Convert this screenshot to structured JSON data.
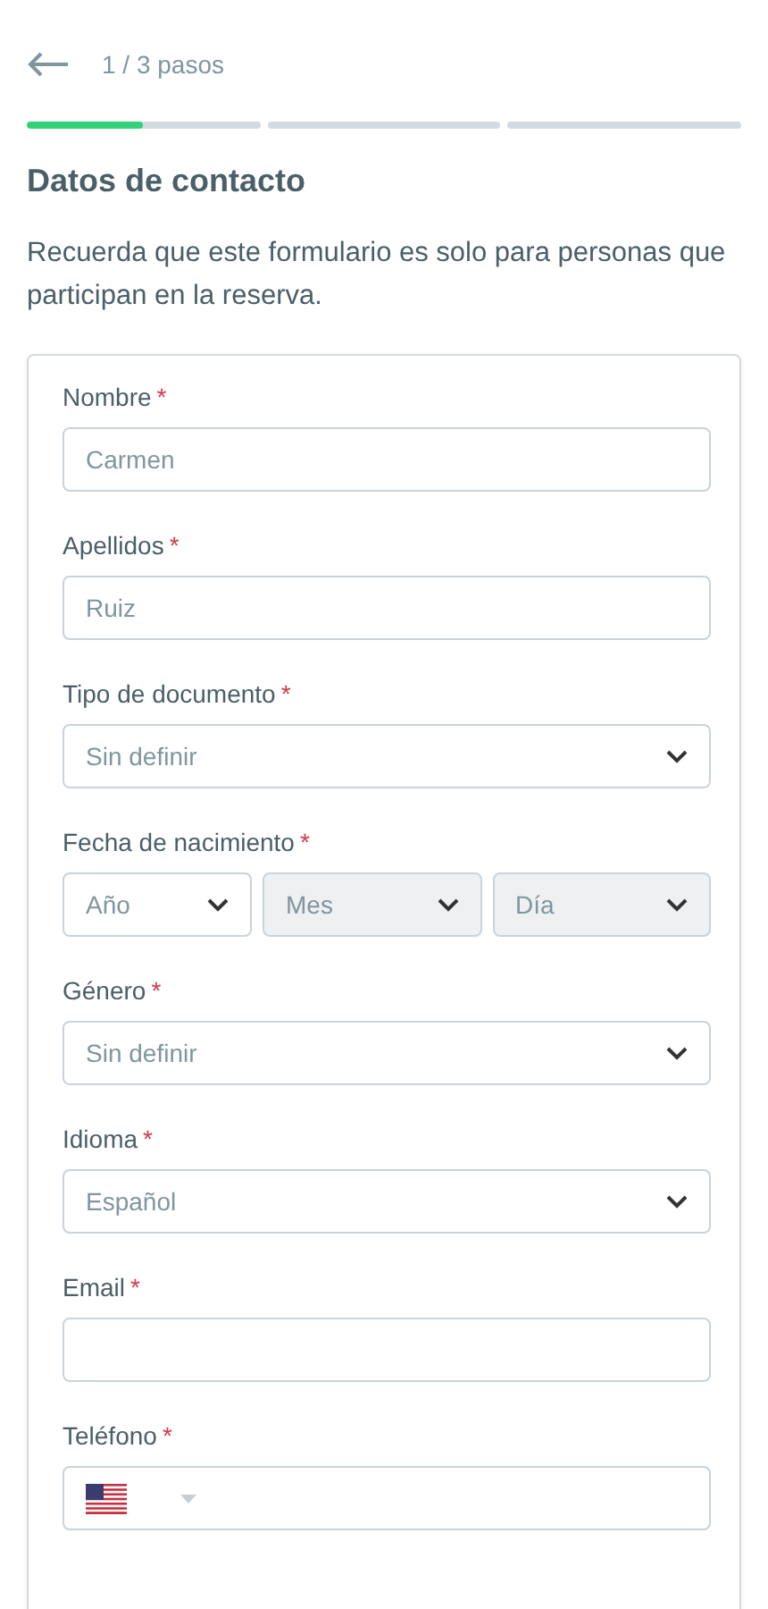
{
  "header": {
    "step_label": "1 / 3 pasos"
  },
  "progress": [
    {
      "level": 0.5
    },
    {
      "level": 0
    },
    {
      "level": 0
    }
  ],
  "title": "Datos de contacto",
  "intro": "Recuerda que este formulario es solo para personas que participan en la reserva.",
  "fields": [
    {
      "kind": "text",
      "label": "Nombre",
      "required_mark": "*",
      "value": "Carmen"
    },
    {
      "kind": "text",
      "label": "Apellidos",
      "required_mark": "*",
      "value": "Ruiz"
    },
    {
      "kind": "select",
      "label": "Tipo de documento",
      "required_mark": "*",
      "value": "Sin definir"
    },
    {
      "kind": "date",
      "label": "Fecha de nacimiento",
      "required_mark": "*",
      "parts": [
        {
          "value": "Año",
          "disabled": false
        },
        {
          "value": "Mes",
          "disabled": true
        },
        {
          "value": "Día",
          "disabled": true
        }
      ]
    },
    {
      "kind": "select",
      "label": "Género",
      "required_mark": "*",
      "value": "Sin definir"
    },
    {
      "kind": "select",
      "label": "Idioma",
      "required_mark": "*",
      "value": "Español"
    },
    {
      "kind": "text",
      "label": "Email",
      "required_mark": "*"
    },
    {
      "kind": "phone",
      "label": "Teléfono",
      "required_mark": "*"
    }
  ]
}
